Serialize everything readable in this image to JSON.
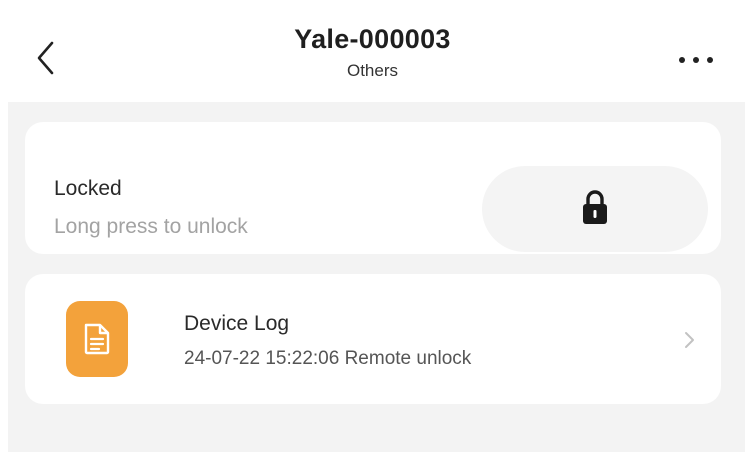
{
  "header": {
    "title": "Yale-000003",
    "subtitle": "Others",
    "back_icon": "chevron-left-icon",
    "more_icon": "more-horizontal-icon"
  },
  "lock_card": {
    "status": "Locked",
    "hint": "Long press to unlock",
    "button_icon": "lock-icon"
  },
  "device_log": {
    "title": "Device Log",
    "last_entry": "24-07-22 15:22:06 Remote unlock",
    "icon": "document-icon",
    "icon_color": "#f3a23b",
    "chevron_icon": "chevron-right-icon"
  },
  "colors": {
    "background": "#f3f3f3",
    "card": "#ffffff",
    "accent": "#f3a23b",
    "hint_text": "#a3a3a3"
  }
}
